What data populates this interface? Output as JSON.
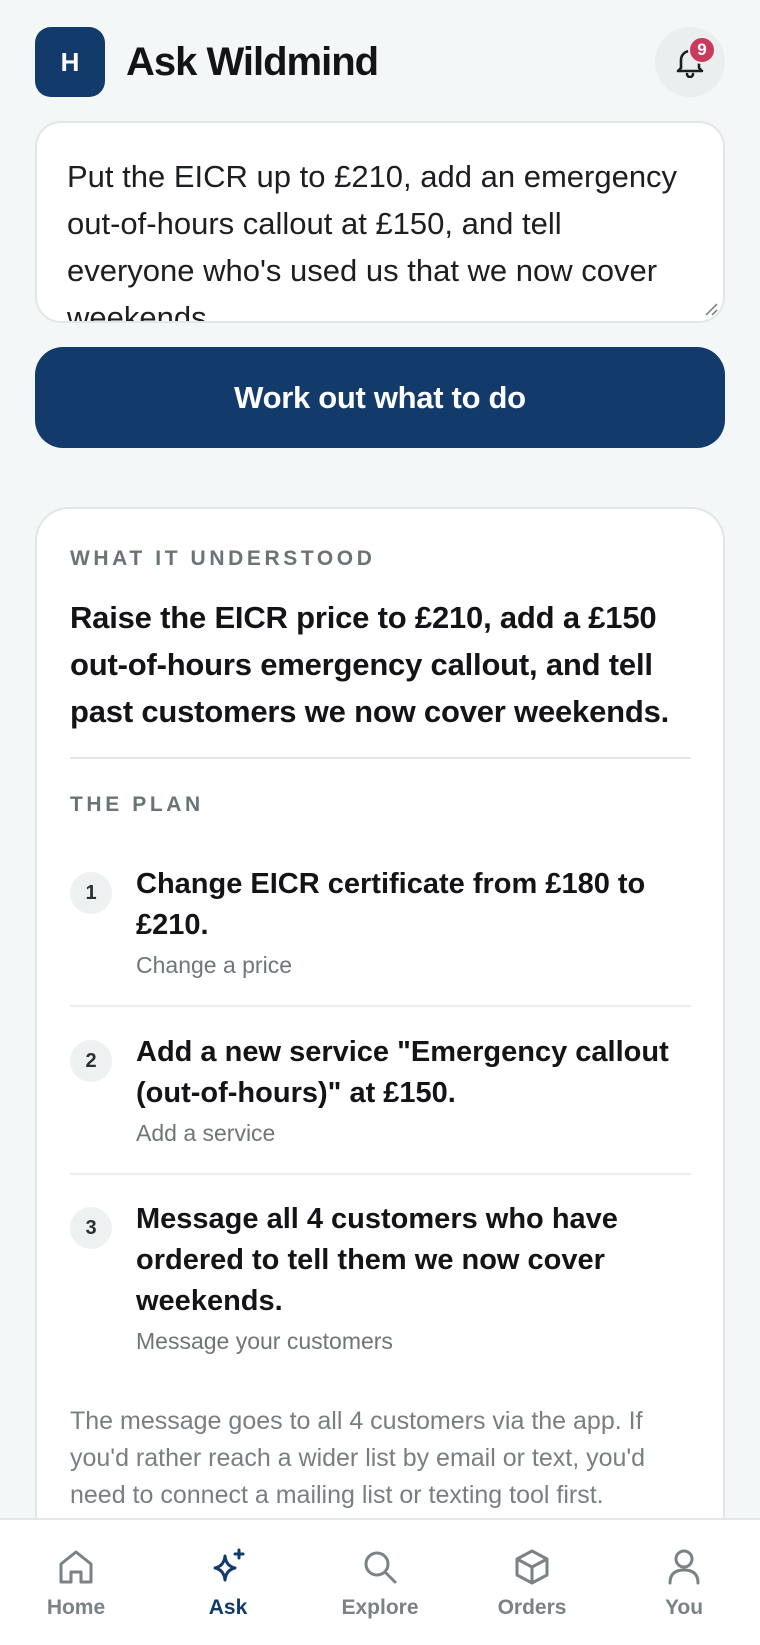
{
  "header": {
    "avatar_initial": "H",
    "title": "Ask Wildmind",
    "notification_count": "9"
  },
  "prompt": {
    "value": "Put the EICR up to £210, add an emergency out-of-hours callout at £150, and tell everyone who's used us that we now cover weekends"
  },
  "primary_button": {
    "label": "Work out what to do"
  },
  "result": {
    "understood_label": "WHAT IT UNDERSTOOD",
    "understood_text": "Raise the EICR price to £210, add a £150 out-of-hours emergency callout, and tell past customers we now cover weekends.",
    "plan_label": "THE PLAN",
    "steps": [
      {
        "num": "1",
        "title": "Change EICR certificate from £180 to £210.",
        "kind": "Change a price"
      },
      {
        "num": "2",
        "title": "Add a new service \"Emergency callout (out-of-hours)\" at £150.",
        "kind": "Add a service"
      },
      {
        "num": "3",
        "title": "Message all 4 customers who have ordered to tell them we now cover weekends.",
        "kind": "Message your customers"
      }
    ],
    "footnote": "The message goes to all 4 customers via the app. If you'd rather reach a wider list by email or text, you'd need to connect a mailing list or texting tool first."
  },
  "nav": {
    "items": [
      {
        "label": "Home",
        "icon": "home-icon"
      },
      {
        "label": "Ask",
        "icon": "sparkle-icon"
      },
      {
        "label": "Explore",
        "icon": "search-icon"
      },
      {
        "label": "Orders",
        "icon": "box-icon"
      },
      {
        "label": "You",
        "icon": "user-icon"
      }
    ],
    "active": "Ask"
  },
  "colors": {
    "brand": "#123a6b",
    "badge": "#c93a5e",
    "background": "#f4f7f7"
  }
}
